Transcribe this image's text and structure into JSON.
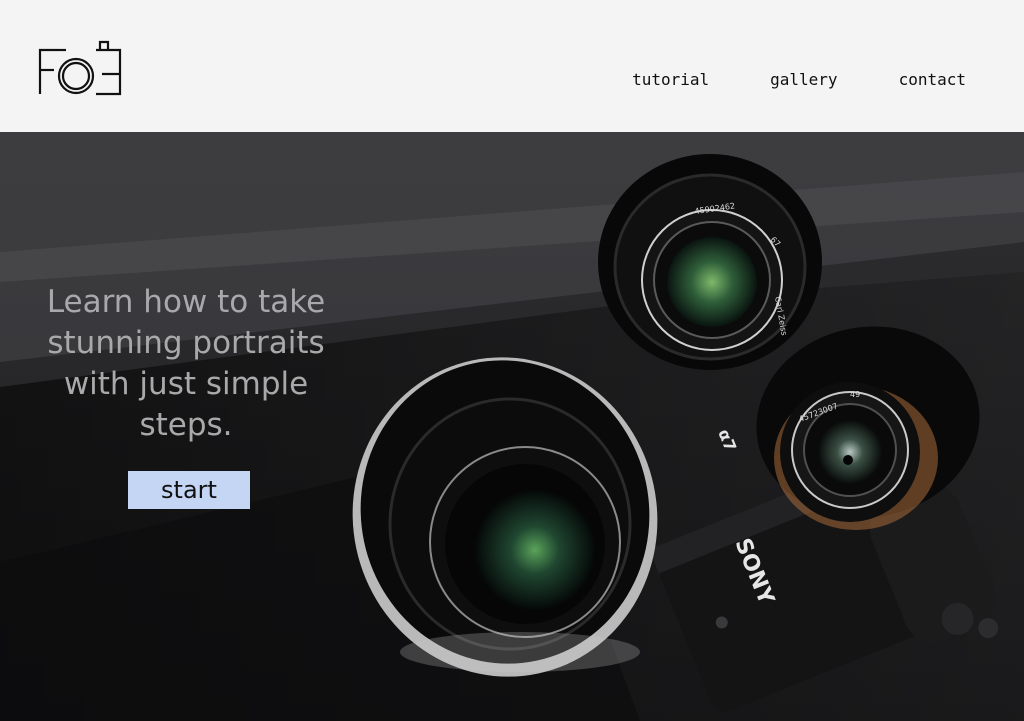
{
  "header": {
    "logo_icon": "camera-logo-icon",
    "nav": [
      {
        "label": "tutorial"
      },
      {
        "label": "gallery"
      },
      {
        "label": "contact"
      }
    ]
  },
  "hero": {
    "headline": "Learn how to take stunning portraits with just simple steps.",
    "cta_label": "start",
    "photo_subject": "camera-and-lenses-photo",
    "lens_text_1": "45902462",
    "lens_text_2": "67",
    "lens_text_3": "45723007",
    "lens_text_4": "49",
    "lens_text_5": "Carl Zeiss",
    "body_brand": "SONY",
    "body_model": "α7"
  },
  "colors": {
    "background": "#f4f4f4",
    "accent_button": "#c4d6f3",
    "headline_text": "#a9a9ab"
  }
}
